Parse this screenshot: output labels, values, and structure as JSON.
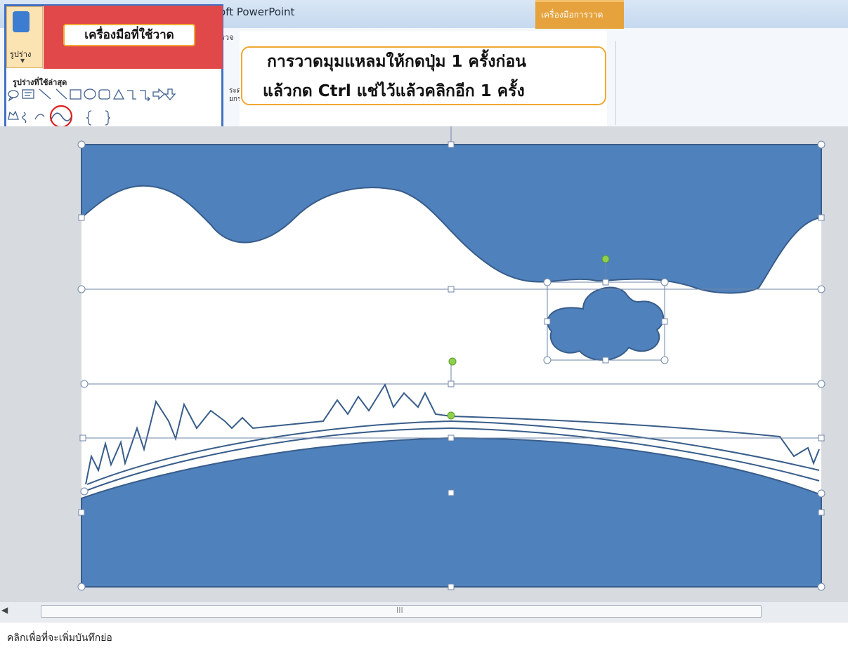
{
  "window": {
    "title_fragment": "oft PowerPoint",
    "context_tab": "เครื่องมือการวาด"
  },
  "ribbon": {
    "fragment_top": "รวจ",
    "fragment_side_1": "ระด",
    "fragment_side_2": "ยกร"
  },
  "shapes_panel": {
    "button_label": "รูปร่าง",
    "banner_label": "เครื่องมือที่ใช้วาด",
    "recent_label": "รูปร่างที่ใช้ล่าสุด",
    "highlighted_shape": "curve-icon"
  },
  "callout": {
    "line1": "การวาดมุมแหลมให้กดปุ่ม 1 ครั้งก่อน",
    "line2": "แล้วกด Ctrl แช่ไว้แล้วคลิกอีก 1 ครั้ง"
  },
  "slide": {
    "fill_color": "#4f81bd",
    "outline_color": "#385d8a"
  },
  "scrollbar": {
    "grip": "III"
  },
  "notes": {
    "placeholder": "คลิกเพื่อที่จะเพิ่มบันทึกย่อ"
  }
}
